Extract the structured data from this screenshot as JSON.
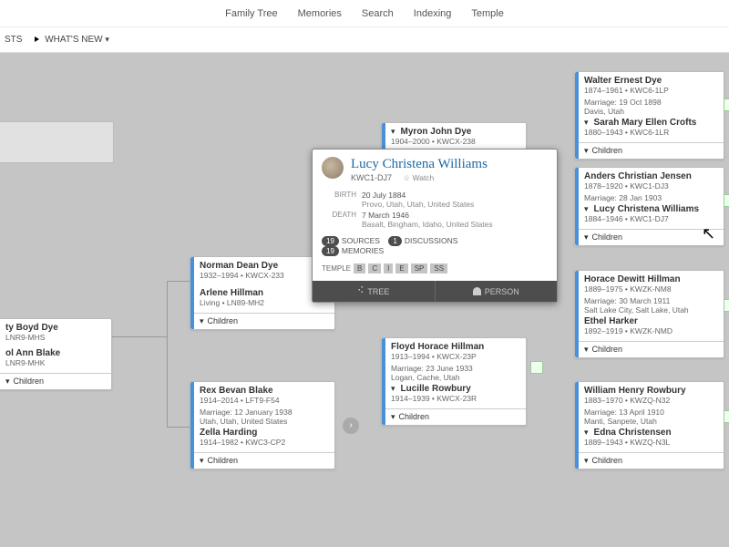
{
  "topnav": [
    "Family Tree",
    "Memories",
    "Search",
    "Indexing",
    "Temple"
  ],
  "subnav": {
    "lists": "STS",
    "whatsnew": "WHAT'S NEW"
  },
  "cards": {
    "root": {
      "name": "ty Boyd Dye",
      "id": "LNR9-MHS",
      "spouse": "ol Ann Blake",
      "spouse_id": "LNR9-MHK",
      "children": "Children"
    },
    "norman": {
      "name": "Norman Dean Dye",
      "life": "1932–1994",
      "id": "KWCX-233",
      "spouse": "Arlene Hillman",
      "spouse_life": "Living",
      "spouse_id": "LN89-MH2",
      "children": "Children"
    },
    "rex": {
      "name": "Rex Bevan Blake",
      "life": "1914–2014",
      "id": "LFT9-F54",
      "marriage": "Marriage: 12 January 1938\nUtah, Utah, United States",
      "spouse": "Zella Harding",
      "spouse_life": "1914–1982",
      "spouse_id": "KWC3-CP2",
      "children": "Children"
    },
    "myron": {
      "name": "Myron John Dye",
      "life": "1904–2000",
      "id": "KWCX-238"
    },
    "floyd": {
      "name": "Floyd Horace Hillman",
      "life": "1913–1994",
      "id": "KWCX-23P",
      "marriage": "Marriage: 23 June 1933\nLogan, Cache, Utah",
      "spouse": "Lucille Rowbury",
      "spouse_life": "1914–1939",
      "spouse_id": "KWCX-23R",
      "children": "Children"
    },
    "walter": {
      "name": "Walter Ernest Dye",
      "life": "1874–1961",
      "id": "KWC6-1LP",
      "marriage": "Marriage: 19 Oct 1898\nDavis, Utah",
      "spouse": "Sarah Mary Ellen Crofts",
      "spouse_life": "1880–1943",
      "spouse_id": "KWC6-1LR",
      "children": "Children"
    },
    "anders": {
      "name": "Anders Christian Jensen",
      "life": "1878–1920",
      "id": "KWC1-DJ3",
      "marriage": "Marriage: 28 Jan 1903",
      "spouse": "Lucy Christena Williams",
      "spouse_life": "1884–1946",
      "spouse_id": "KWC1-DJ7",
      "children": "Children"
    },
    "horace": {
      "name": "Horace Dewitt Hillman",
      "life": "1889–1975",
      "id": "KWZK-NM8",
      "marriage": "Marriage: 30 March 1911\nSalt Lake City, Salt Lake, Utah",
      "spouse": "Ethel Harker",
      "spouse_life": "1892–1919",
      "spouse_id": "KWZK-NMD",
      "children": "Children"
    },
    "william": {
      "name": "William Henry Rowbury",
      "life": "1883–1970",
      "id": "KWZQ-N32",
      "marriage": "Marriage: 13 April 1910\nManti, Sanpete, Utah",
      "spouse": "Edna Christensen",
      "spouse_life": "1889–1943",
      "spouse_id": "KWZQ-N3L",
      "children": "Children"
    }
  },
  "popup": {
    "name": "Lucy Christena Williams",
    "id": "KWC1-DJ7",
    "watch": "Watch",
    "birth_lbl": "BIRTH",
    "birth": "20 July 1884",
    "birth_place": "Provo, Utah, Utah, United States",
    "death_lbl": "DEATH",
    "death": "7 March 1946",
    "death_place": "Basalt, Bingham, Idaho, United States",
    "sources_count": "19",
    "sources_lbl": "SOURCES",
    "disc_count": "1",
    "disc_lbl": "DISCUSSIONS",
    "mem_count": "19",
    "mem_lbl": "MEMORIES",
    "temple_lbl": "TEMPLE",
    "temple": [
      "B",
      "C",
      "I",
      "E",
      "SP",
      "SS"
    ],
    "tree_btn": "TREE",
    "person_btn": "PERSON"
  }
}
